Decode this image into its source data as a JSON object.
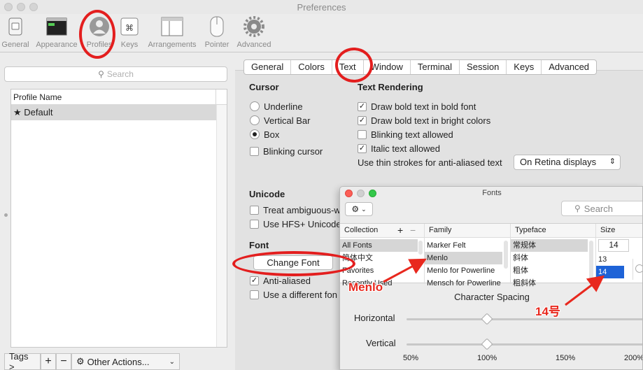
{
  "window": {
    "title": "Preferences"
  },
  "toolbar": {
    "items": [
      {
        "label": "General",
        "icon": "switch-icon"
      },
      {
        "label": "Appearance",
        "icon": "terminal-window-icon"
      },
      {
        "label": "Profiles",
        "icon": "person-silhouette-icon"
      },
      {
        "label": "Keys",
        "icon": "command-key-icon"
      },
      {
        "label": "Arrangements",
        "icon": "windows-arrangement-icon"
      },
      {
        "label": "Pointer",
        "icon": "mouse-icon"
      },
      {
        "label": "Advanced",
        "icon": "gear-icon"
      }
    ],
    "selected": "Profiles"
  },
  "sidebar": {
    "search_placeholder": "Search",
    "table_header": "Profile Name",
    "profiles": [
      "★ Default"
    ],
    "bottom": {
      "tags": "Tags >",
      "add": "+",
      "remove": "−",
      "other_actions": "Other Actions..."
    }
  },
  "tabs": [
    "General",
    "Colors",
    "Text",
    "Window",
    "Terminal",
    "Session",
    "Keys",
    "Advanced"
  ],
  "selected_tab": "Text",
  "cursor": {
    "title": "Cursor",
    "options": [
      {
        "label": "Underline",
        "selected": false
      },
      {
        "label": "Vertical Bar",
        "selected": false
      },
      {
        "label": "Box",
        "selected": true
      }
    ],
    "blinking": {
      "label": "Blinking cursor",
      "checked": false
    }
  },
  "text_rendering": {
    "title": "Text Rendering",
    "options": [
      {
        "label": "Draw bold text in bold font",
        "checked": true
      },
      {
        "label": "Draw bold text in bright colors",
        "checked": true
      },
      {
        "label": "Blinking text allowed",
        "checked": false
      },
      {
        "label": "Italic text allowed",
        "checked": true
      }
    ],
    "thin_strokes_label": "Use thin strokes for anti-aliased text",
    "thin_strokes_value": "On Retina displays"
  },
  "unicode": {
    "title": "Unicode",
    "options": [
      {
        "label": "Treat ambiguous-w",
        "checked": false
      },
      {
        "label": "Use HFS+ Unicode",
        "checked": false
      }
    ]
  },
  "font": {
    "title": "Font",
    "change_button": "Change Font",
    "anti_aliased": {
      "label": "Anti-aliased",
      "checked": true
    },
    "different_font": {
      "label": "Use a different fon",
      "checked": false
    }
  },
  "fonts_dialog": {
    "title": "Fonts",
    "search_placeholder": "Search",
    "collection": {
      "header": "Collection",
      "add": "+",
      "remove": "−",
      "items": [
        "All Fonts",
        "简体中文",
        "Favorites",
        "Recently Used"
      ],
      "selected": "All Fonts"
    },
    "family": {
      "header": "Family",
      "items": [
        "Marker Felt",
        "Menlo",
        "Menlo for Powerline",
        "Mensch for Powerline"
      ],
      "selected": "Menlo"
    },
    "typeface": {
      "header": "Typeface",
      "items": [
        "常规体",
        "斜体",
        "粗体",
        "粗斜体"
      ],
      "selected": "常规体"
    },
    "size": {
      "header": "Size",
      "value": "14",
      "items": [
        "13",
        "14"
      ],
      "selected": "14"
    },
    "character_spacing": "Character Spacing",
    "horizontal_label": "Horizontal",
    "vertical_label": "Vertical",
    "horizontal_value_pct": 100,
    "vertical_value_pct": 100,
    "scale_labels": [
      "50%",
      "100%",
      "150%",
      "200%"
    ]
  },
  "annotations": {
    "menlo": "Menlo",
    "size": "14号"
  },
  "colors": {
    "annotation_red": "#e31e1e",
    "selection_blue": "#1e63d7"
  }
}
